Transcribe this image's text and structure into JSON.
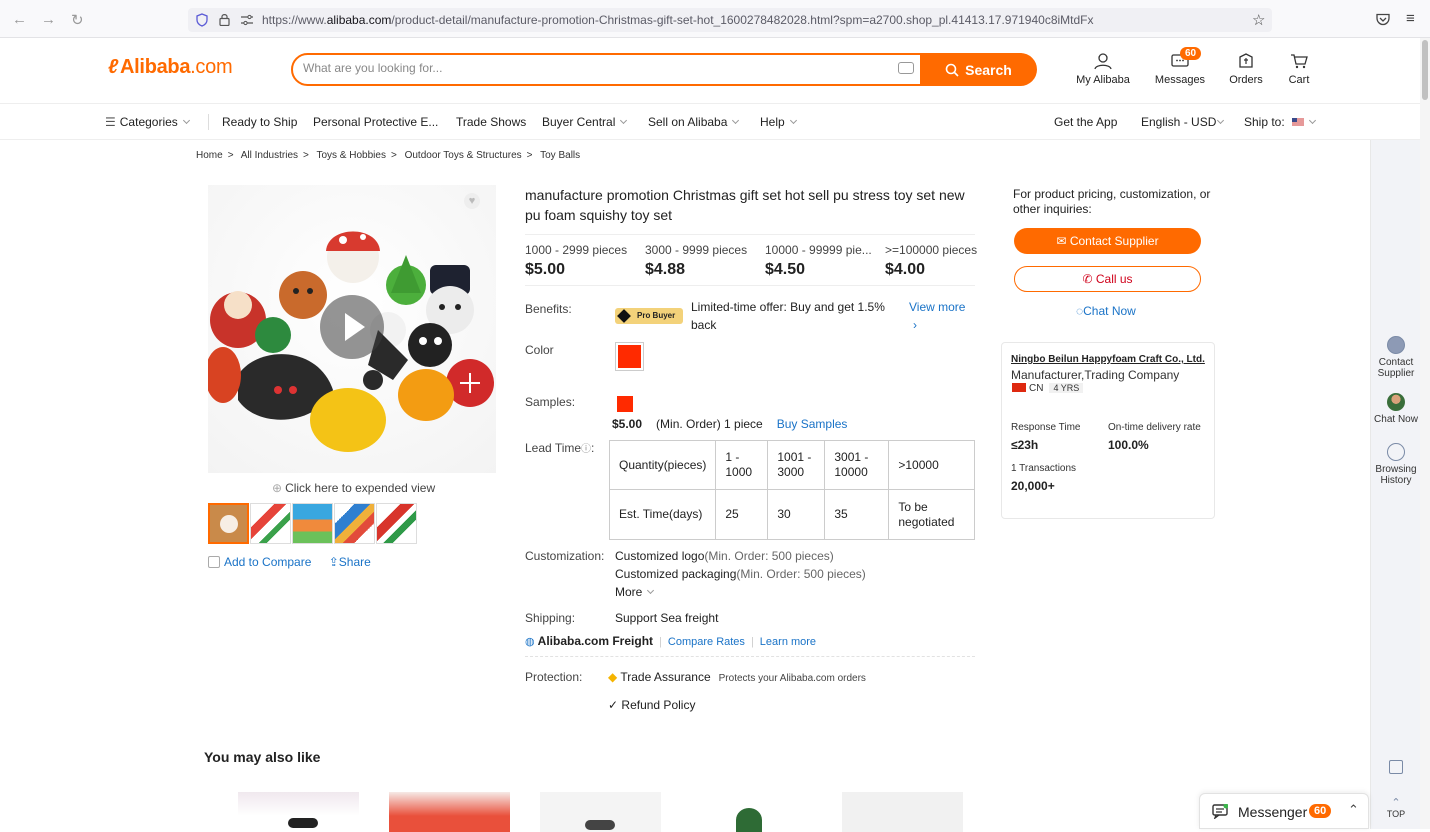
{
  "browser": {
    "url_prefix": "https://www.",
    "url_domain": "alibaba.com",
    "url_rest": "/product-detail/manufacture-promotion-Christmas-gift-set-hot_1600278482028.html?spm=a2700.shop_pl.41413.17.971940c8iMtdFx"
  },
  "header": {
    "logo": "Alibaba",
    "logo_suffix": ".com",
    "search_placeholder": "What are you looking for...",
    "search_button": "Search",
    "my_alibaba": "My Alibaba",
    "messages": "Messages",
    "messages_badge": "60",
    "orders": "Orders",
    "cart": "Cart"
  },
  "nav": {
    "categories": "Categories",
    "items": [
      "Ready to Ship",
      "Personal Protective E...",
      "Trade Shows",
      "Buyer Central",
      "Sell on Alibaba",
      "Help"
    ],
    "get_app": "Get the App",
    "language": "English - USD",
    "ship_to": "Ship to:"
  },
  "breadcrumbs": [
    "Home",
    "All Industries",
    "Toys & Hobbies",
    "Outdoor Toys & Structures",
    "Toy Balls"
  ],
  "gallery": {
    "expanded_view": "Click here to expended view",
    "add_to_compare": "Add to Compare",
    "share": "Share"
  },
  "product": {
    "title": "manufacture promotion Christmas gift set hot sell pu stress toy set new pu foam squishy toy set",
    "tiers": [
      {
        "qty": "1000 - 2999 pieces",
        "price": "$5.00"
      },
      {
        "qty": "3000 - 9999 pieces",
        "price": "$4.88"
      },
      {
        "qty": "10000 - 99999 pie...",
        "price": "$4.50"
      },
      {
        "qty": ">=100000 pieces",
        "price": "$4.00"
      }
    ],
    "benefits_label": "Benefits:",
    "pro_buyer": "Pro Buyer",
    "offer": "Limited-time offer: Buy and get 1.5% back",
    "view_more": "View more",
    "color_label": "Color",
    "samples_label": "Samples:",
    "sample_price": "$5.00",
    "sample_min": "(Min. Order) 1 piece",
    "buy_samples": "Buy Samples",
    "lead_time_label": "Lead Time",
    "lead_table": {
      "row1": [
        "Quantity(pieces)",
        "1 - 1000",
        "1001 - 3000",
        "3001 - 10000",
        ">10000"
      ],
      "row2": [
        "Est. Time(days)",
        "25",
        "30",
        "35",
        "To be negotiated"
      ]
    },
    "customization_label": "Customization:",
    "custom_logo": "Customized logo",
    "custom_logo_min": "(Min. Order: 500 pieces)",
    "custom_pack": "Customized packaging",
    "custom_pack_min": "(Min. Order: 500 pieces)",
    "more": "More",
    "shipping_label": "Shipping:",
    "shipping_value": "Support Sea freight",
    "freight": "Alibaba.com Freight",
    "compare_rates": "Compare Rates",
    "learn_more": "Learn more",
    "protection_label": "Protection:",
    "trade_assurance": "Trade Assurance",
    "ta_desc": "Protects your Alibaba.com orders",
    "refund": "Refund Policy"
  },
  "supplier": {
    "inquiry": "For product pricing, customization, or other inquiries:",
    "contact": "Contact Supplier",
    "call": "Call us",
    "chat": "Chat Now",
    "name": "Ningbo Beilun Happyfoam Craft Co., Ltd.",
    "type": "Manufacturer,Trading Company",
    "country": "CN",
    "years": "4 YRS",
    "response_label": "Response Time",
    "response_value": "≤23h",
    "ontime_label": "On-time delivery rate",
    "ontime_value": "100.0%",
    "transactions_label": "1 Transactions",
    "transactions_value": "20,000+"
  },
  "rail": {
    "contact": "Contact Supplier",
    "chat": "Chat Now",
    "history": "Browsing History",
    "top": "TOP"
  },
  "also_like": "You may also like",
  "messenger": {
    "label": "Messenger",
    "badge": "60"
  },
  "colors": {
    "accent": "#ff6a00",
    "link": "#1a73c7",
    "swatch": "#ff2a00"
  }
}
